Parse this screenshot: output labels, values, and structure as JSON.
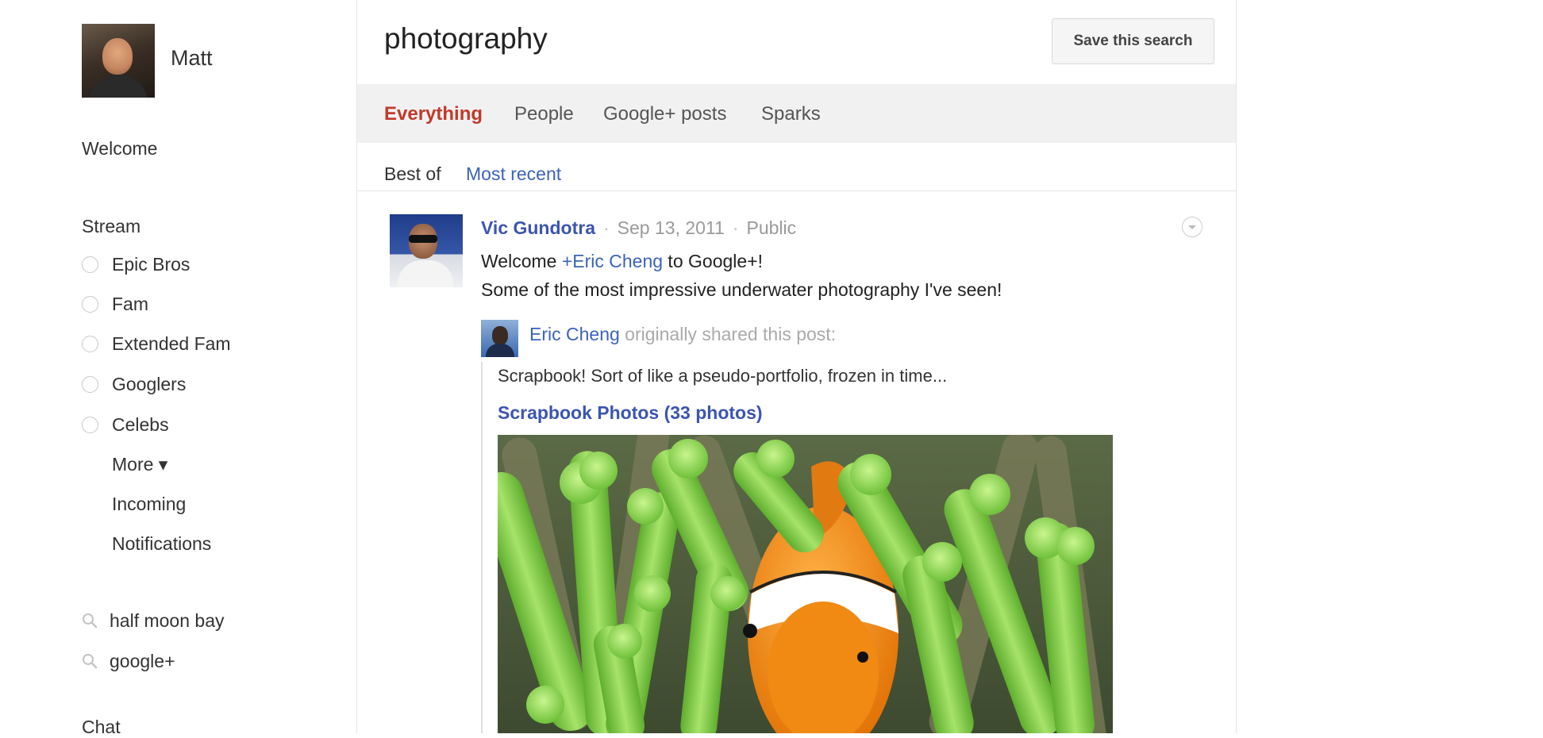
{
  "user": {
    "name": "Matt"
  },
  "sidebar": {
    "welcome": "Welcome",
    "stream_title": "Stream",
    "circles": [
      "Epic Bros",
      "Fam",
      "Extended Fam",
      "Googlers",
      "Celebs"
    ],
    "more": "More ▾",
    "incoming": "Incoming",
    "notifications": "Notifications",
    "saved_searches": [
      "half moon bay",
      "google+"
    ],
    "chat_title": "Chat"
  },
  "search": {
    "query": "photography",
    "save_label": "Save this search",
    "tabs": [
      "Everything",
      "People",
      "Google+ posts",
      "Sparks"
    ],
    "active_tab": "Everything",
    "filters": {
      "best_of": "Best of",
      "most_recent": "Most recent"
    }
  },
  "post": {
    "author": "Vic Gundotra",
    "date": "Sep 13, 2011",
    "visibility": "Public",
    "line1_prefix": "Welcome ",
    "line1_mention": "+Eric Cheng",
    "line1_suffix": " to Google+!",
    "line2": "Some of the most impressive underwater photography I've seen!",
    "reshare": {
      "author": "Eric Cheng",
      "note": " originally shared this post:",
      "text": "Scrapbook! Sort of like a pseudo-portfolio, frozen in time...",
      "album_link": "Scrapbook Photos (33 photos)"
    }
  },
  "colors": {
    "active_tab": "#c03a2b",
    "link": "#3b63b8",
    "author": "#3b55b0",
    "tab_bar": "#f1f1f1"
  }
}
